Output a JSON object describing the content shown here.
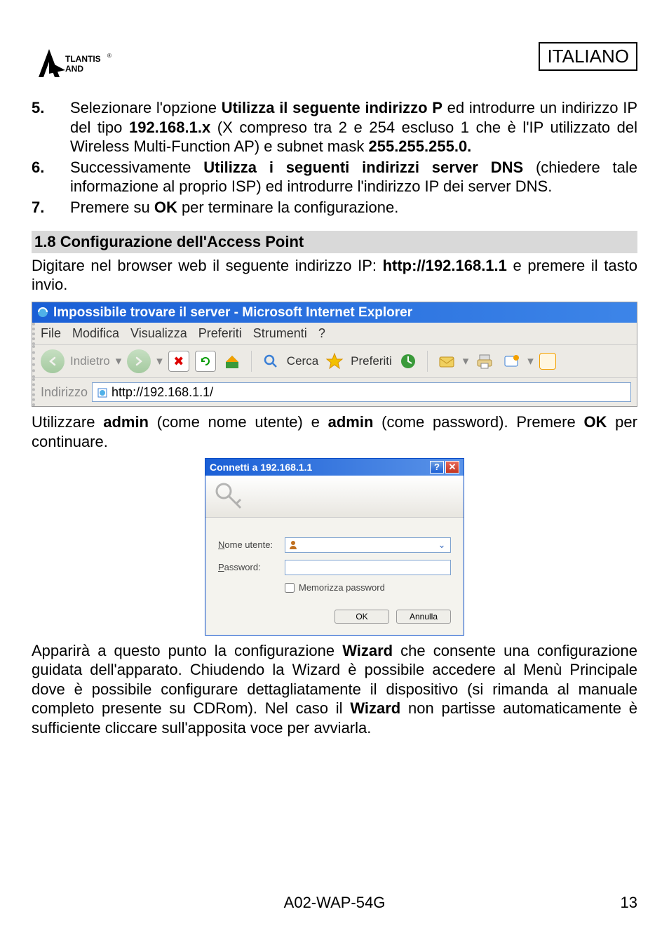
{
  "header": {
    "lang": "ITALIANO",
    "logo_alt": "Atlantis Land"
  },
  "steps": [
    {
      "num": "5.",
      "parts": [
        {
          "t": "Selezionare l'opzione "
        },
        {
          "t": "Utilizza il seguente indirizzo P",
          "b": true
        },
        {
          "t": " ed introdurre un indirizzo IP del tipo "
        },
        {
          "t": "192.168.1.x",
          "b": true
        },
        {
          "t": " (X compreso tra 2 e 254 escluso 1 che è l'IP utilizzato del Wireless Multi-Function AP) e subnet mask "
        },
        {
          "t": "255.255.255.0.",
          "b": true
        }
      ]
    },
    {
      "num": "6.",
      "parts": [
        {
          "t": "Successivamente "
        },
        {
          "t": "Utilizza i seguenti indirizzi server DNS",
          "b": true
        },
        {
          "t": " (chiedere tale informazione al proprio ISP) ed introdurre l'indirizzo IP dei server DNS."
        }
      ]
    },
    {
      "num": "7.",
      "parts": [
        {
          "t": "Premere su  "
        },
        {
          "t": "OK",
          "b": true
        },
        {
          "t": " per terminare la configurazione."
        }
      ]
    }
  ],
  "section_title": "1.8 Configurazione dell'Access Point",
  "para1": [
    {
      "t": "Digitare nel browser web il seguente indirizzo IP: "
    },
    {
      "t": "http://192.168.1.1",
      "b": true
    },
    {
      "t": "  e premere il tasto invio."
    }
  ],
  "browser": {
    "title": "Impossibile trovare il server - Microsoft Internet Explorer",
    "menu": [
      "File",
      "Modifica",
      "Visualizza",
      "Preferiti",
      "Strumenti",
      "?"
    ],
    "back_label": "Indietro",
    "search_label": "Cerca",
    "fav_label": "Preferiti",
    "addr_label": "Indirizzo",
    "addr_value": "http://192.168.1.1/"
  },
  "para2": [
    {
      "t": "Utilizzare "
    },
    {
      "t": "admin",
      "b": true
    },
    {
      "t": " (come nome utente) e "
    },
    {
      "t": "admin",
      "b": true
    },
    {
      "t": " (come password). Premere "
    },
    {
      "t": "OK",
      "b": true
    },
    {
      "t": " per continuare."
    }
  ],
  "login": {
    "title": "Connetti a 192.168.1.1",
    "user_label": "Nome utente:",
    "pass_label": "Password:",
    "remember_label": "Memorizza password",
    "ok_label": "OK",
    "cancel_label": "Annulla"
  },
  "para3": [
    {
      "t": "Apparirà a questo punto la configurazione "
    },
    {
      "t": "Wizard",
      "b": true
    },
    {
      "t": " che consente una configurazione guidata dell'apparato. Chiudendo la Wizard è possibile accedere al  Menù Principale dove è possibile configurare dettagliatamente il dispositivo (si rimanda al manuale completo presente su CDRom).  Nel caso il "
    },
    {
      "t": "Wizard",
      "b": true
    },
    {
      "t": " non partisse automaticamente è sufficiente cliccare sull'apposita voce per avviarla."
    }
  ],
  "footer": {
    "model": "A02-WAP-54G",
    "page": "13"
  }
}
